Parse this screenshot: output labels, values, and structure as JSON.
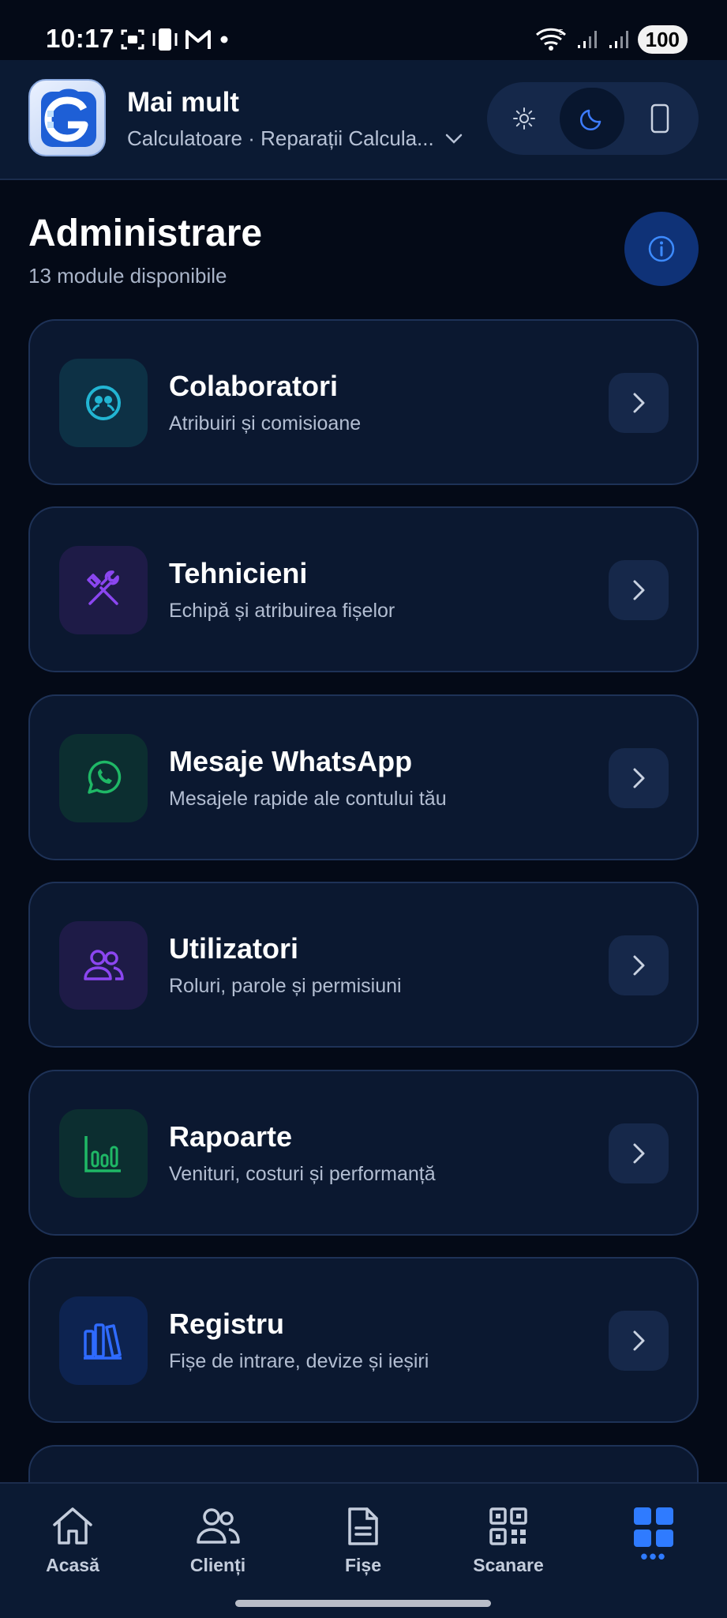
{
  "status_bar": {
    "time": "10:17",
    "battery": "100",
    "icons": [
      "screenshot-icon",
      "phone-vibrate-icon",
      "gmail-icon",
      "dot-icon",
      "wifi-icon",
      "signal-icon",
      "signal-icon"
    ]
  },
  "header": {
    "logo_letter": "G",
    "title": "Mai mult",
    "subtitle": "Calculatoare · Reparații Calcula...",
    "theme_options": [
      "sun-icon",
      "moon-icon",
      "phone-icon"
    ],
    "active_theme": "dark"
  },
  "section": {
    "title": "Administrare",
    "count": "13 module disponibile"
  },
  "modules": [
    {
      "title": "Colaboratori",
      "subtitle": "Atribuiri și comisioane",
      "icon": "collaborators-icon",
      "color": "#22b5d3",
      "bg": "#0d3145"
    },
    {
      "title": "Tehnicieni",
      "subtitle": "Echipă și atribuirea fișelor",
      "icon": "tools-icon",
      "color": "#8b46f0",
      "bg": "#1e1b47"
    },
    {
      "title": "Mesaje WhatsApp",
      "subtitle": "Mesajele rapide ale contului tău",
      "icon": "whatsapp-icon",
      "color": "#1fb866",
      "bg": "#0c2e30"
    },
    {
      "title": "Utilizatori",
      "subtitle": "Roluri, parole și permisiuni",
      "icon": "users-icon",
      "color": "#8b46f0",
      "bg": "#1e1b47"
    },
    {
      "title": "Rapoarte",
      "subtitle": "Venituri, costuri și performanță",
      "icon": "bar-chart-icon",
      "color": "#1fb866",
      "bg": "#0c2e30"
    },
    {
      "title": "Registru",
      "subtitle": "Fișe de intrare, devize și ieșiri",
      "icon": "books-icon",
      "color": "#2f6bff",
      "bg": "#0d2350"
    }
  ],
  "nav": {
    "items": [
      {
        "label": "Acasă",
        "icon": "home-icon"
      },
      {
        "label": "Clienți",
        "icon": "clients-icon"
      },
      {
        "label": "Fișe",
        "icon": "document-icon"
      },
      {
        "label": "Scanare",
        "icon": "qr-code-icon"
      },
      {
        "label": "•••",
        "icon": "grid-icon",
        "active": true
      }
    ],
    "active_color": "#2f7bff"
  }
}
